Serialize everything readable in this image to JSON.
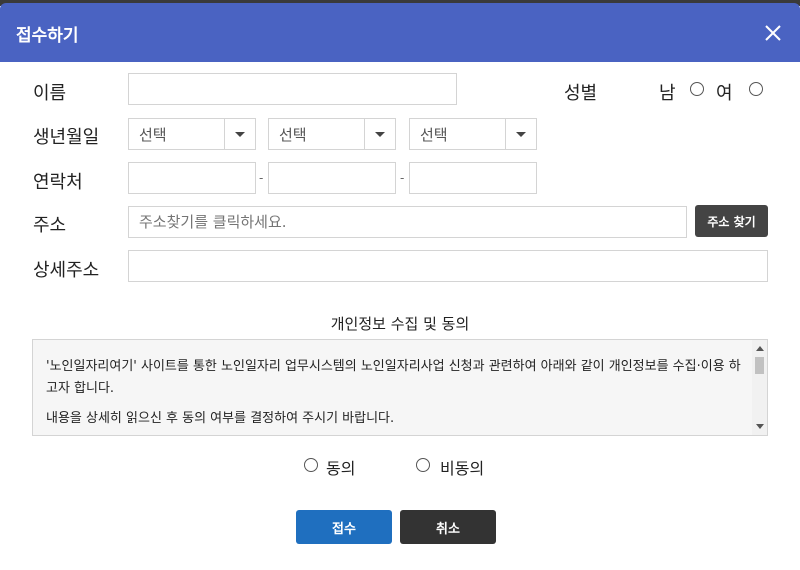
{
  "dialog": {
    "title": "접수하기"
  },
  "form": {
    "name_label": "이름",
    "name_value": "",
    "gender_label": "성별",
    "gender_male": "남",
    "gender_female": "여",
    "birth_label": "생년월일",
    "birth_year": "선택",
    "birth_month": "선택",
    "birth_day": "선택",
    "phone_label": "연락처",
    "phone_sep": "-",
    "phone_1": "",
    "phone_2": "",
    "phone_3": "",
    "address_label": "주소",
    "address_placeholder": "주소찾기를 클릭하세요.",
    "address_button": "주소 찾기",
    "detail_label": "상세주소",
    "detail_value": ""
  },
  "privacy": {
    "title": "개인정보 수집 및 동의",
    "paragraph_1": "'노인일자리여기' 사이트를 통한 노인일자리 업무시스템의 노인일자리사업 신청과 관련하여 아래와 같이 개인정보를 수집·이용 하고자 합니다.",
    "paragraph_2": "내용을 상세히 읽으신 후 동의 여부를 결정하여 주시기 바랍니다.",
    "agree_label": "동의",
    "disagree_label": "비동의"
  },
  "actions": {
    "submit_label": "접수",
    "cancel_label": "취소"
  },
  "colors": {
    "header": "#4a63c2",
    "submit": "#1f6fbf",
    "cancel": "#333333",
    "address_button": "#444444"
  }
}
